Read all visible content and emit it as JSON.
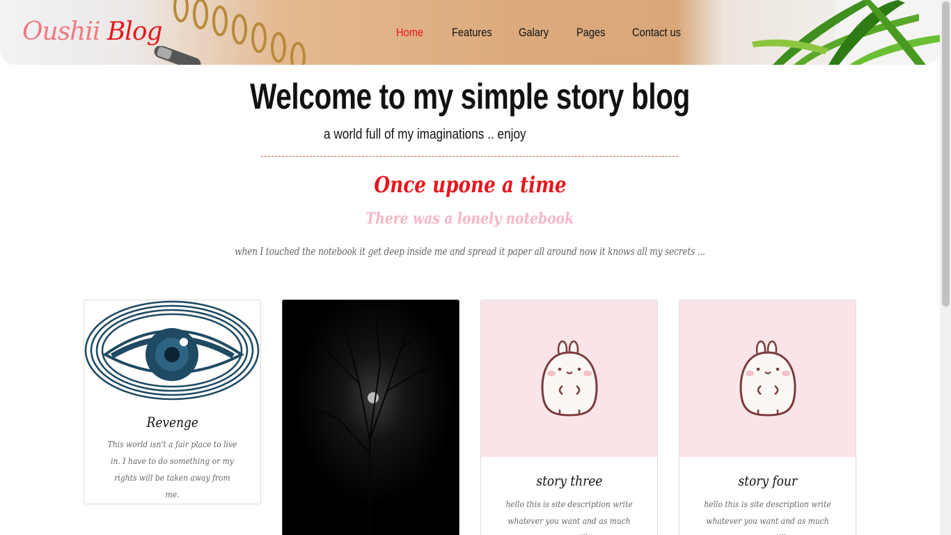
{
  "header": {
    "logo_part1": "Oushii",
    "logo_part2": "Blog",
    "nav": [
      {
        "label": "Home",
        "active": true
      },
      {
        "label": "Features",
        "active": false
      },
      {
        "label": "Galary",
        "active": false
      },
      {
        "label": "Pages",
        "active": false
      },
      {
        "label": "Contact us",
        "active": false
      }
    ]
  },
  "hero": {
    "title": "Welcome to my simple story blog",
    "subtitle": "a world full of my imaginations .. enjoy"
  },
  "intro": {
    "heading": "Once upone a time",
    "subheading": "There was a lonely notebook",
    "text": "when I touched the notebook it get deep inside me and spread it paper all around now it knows all my secrets ..."
  },
  "cards": [
    {
      "title": "Revenge",
      "text": "This world isn't a fair place to live in. I have to do something or my rights will be taken away from me.",
      "image": "eye-illustration"
    },
    {
      "title": "",
      "text": "",
      "image": "dark-forest-moon"
    },
    {
      "title": "story three",
      "text": "hello this is site description write whatever you want and as much as you can till you",
      "image": "bunny-character"
    },
    {
      "title": "story four",
      "text": "hello this is site description write whatever you want and as much as you can till you",
      "image": "bunny-character"
    }
  ],
  "colors": {
    "accent": "#e8161c",
    "logo_light": "#f07880",
    "pink_heading": "#f7b6c5",
    "card_pink_bg": "#fbe4e8"
  }
}
